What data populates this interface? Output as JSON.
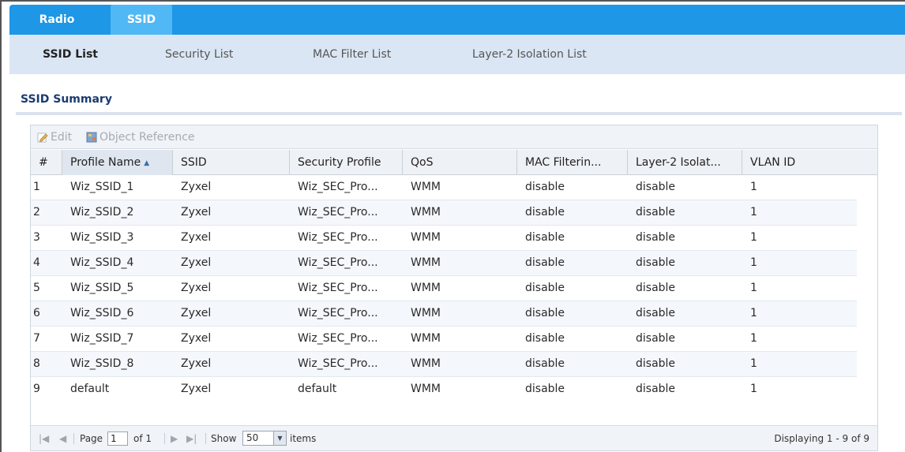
{
  "top_tabs": [
    {
      "label": "Radio",
      "active": false
    },
    {
      "label": "SSID",
      "active": true
    }
  ],
  "sub_tabs": [
    {
      "label": "SSID List",
      "active": true
    },
    {
      "label": "Security List",
      "active": false
    },
    {
      "label": "MAC Filter List",
      "active": false
    },
    {
      "label": "Layer-2 Isolation List",
      "active": false
    }
  ],
  "section_title": "SSID Summary",
  "toolbar": {
    "edit_label": "Edit",
    "object_reference_label": "Object Reference"
  },
  "columns": [
    "#",
    "Profile Name",
    "SSID",
    "Security Profile",
    "QoS",
    "MAC Filterin...",
    "Layer-2 Isolat...",
    "VLAN ID"
  ],
  "sorted_column": "Profile Name",
  "rows": [
    [
      "1",
      "Wiz_SSID_1",
      "Zyxel",
      "Wiz_SEC_Pro...",
      "WMM",
      "disable",
      "disable",
      "1"
    ],
    [
      "2",
      "Wiz_SSID_2",
      "Zyxel",
      "Wiz_SEC_Pro...",
      "WMM",
      "disable",
      "disable",
      "1"
    ],
    [
      "3",
      "Wiz_SSID_3",
      "Zyxel",
      "Wiz_SEC_Pro...",
      "WMM",
      "disable",
      "disable",
      "1"
    ],
    [
      "4",
      "Wiz_SSID_4",
      "Zyxel",
      "Wiz_SEC_Pro...",
      "WMM",
      "disable",
      "disable",
      "1"
    ],
    [
      "5",
      "Wiz_SSID_5",
      "Zyxel",
      "Wiz_SEC_Pro...",
      "WMM",
      "disable",
      "disable",
      "1"
    ],
    [
      "6",
      "Wiz_SSID_6",
      "Zyxel",
      "Wiz_SEC_Pro...",
      "WMM",
      "disable",
      "disable",
      "1"
    ],
    [
      "7",
      "Wiz_SSID_7",
      "Zyxel",
      "Wiz_SEC_Pro...",
      "WMM",
      "disable",
      "disable",
      "1"
    ],
    [
      "8",
      "Wiz_SSID_8",
      "Zyxel",
      "Wiz_SEC_Pro...",
      "WMM",
      "disable",
      "disable",
      "1"
    ],
    [
      "9",
      "default",
      "Zyxel",
      "default",
      "WMM",
      "disable",
      "disable",
      "1"
    ]
  ],
  "pager": {
    "page_label": "Page",
    "page_value": "1",
    "of_label": "of 1",
    "show_label": "Show",
    "show_value": "50",
    "items_label": "items",
    "display_text": "Displaying 1 - 9 of 9"
  },
  "colors": {
    "tab_bar": "#1d97e6",
    "tab_active": "#4fb8f5",
    "subtab_bar": "#dbe6f4",
    "section_title": "#1b3c72"
  }
}
